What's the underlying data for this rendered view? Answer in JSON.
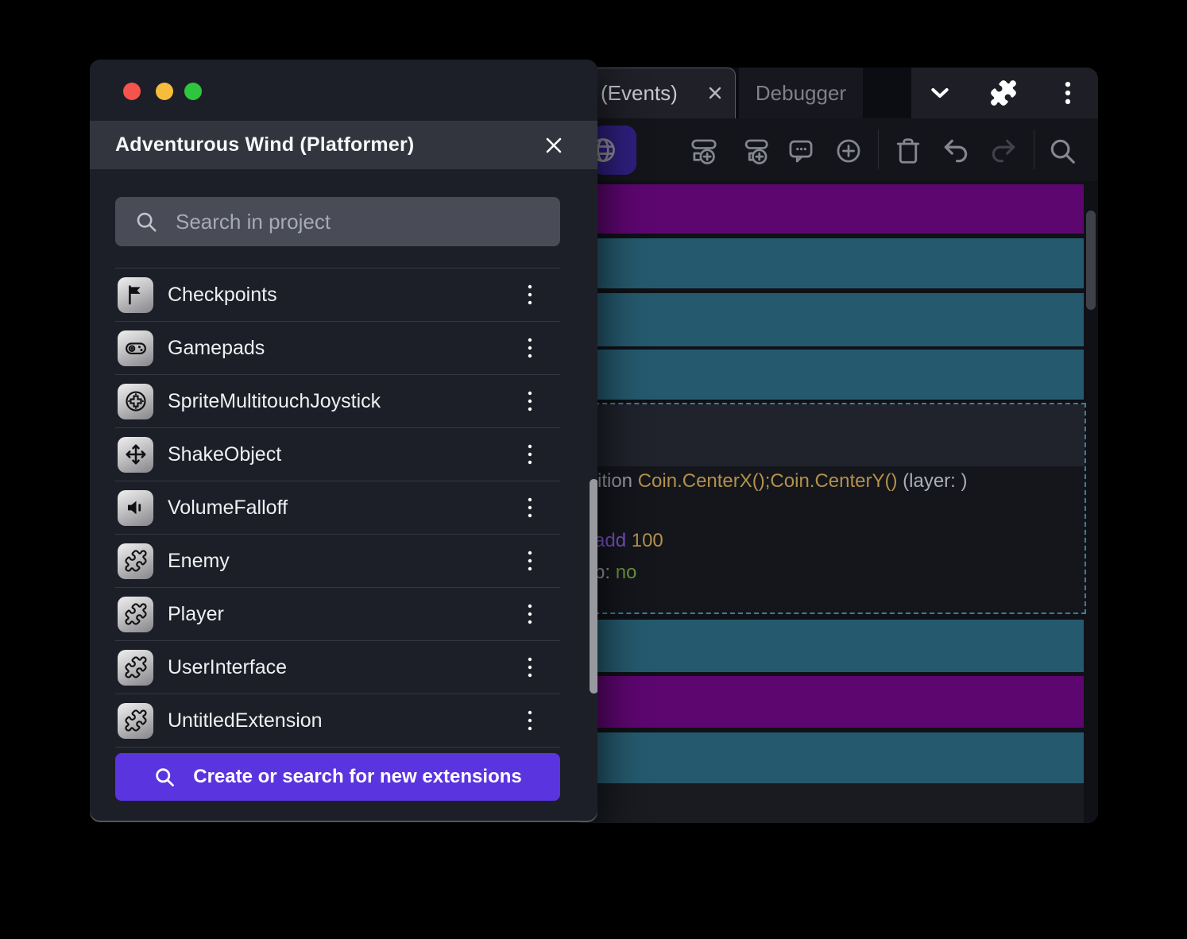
{
  "colors": {
    "row-purple": "#5d0670",
    "row-teal": "#255a6e",
    "accent-button": "#5a34df",
    "toolbar-accent": "#2e1f7e",
    "selection-border": "#3e7d99",
    "code-gold": "#b3914c",
    "code-purple": "#7b50c8",
    "code-green": "#6d9340",
    "code-gray": "#979ca6",
    "traffic-red": "#f4544c",
    "traffic-yellow": "#f6bd3c",
    "traffic-green": "#2dc63e"
  },
  "dialog": {
    "title": "Adventurous Wind (Platformer)",
    "search": {
      "placeholder": "Search in project",
      "icon": "search-icon"
    },
    "items": [
      {
        "label": "Checkpoints",
        "icon": "flag-icon"
      },
      {
        "label": "Gamepads",
        "icon": "gamepad-icon"
      },
      {
        "label": "SpriteMultitouchJoystick",
        "icon": "joystick-icon"
      },
      {
        "label": "ShakeObject",
        "icon": "move-arrows-icon"
      },
      {
        "label": "VolumeFalloff",
        "icon": "speaker-icon"
      },
      {
        "label": "Enemy",
        "icon": "puzzle-icon"
      },
      {
        "label": "Player",
        "icon": "puzzle-icon"
      },
      {
        "label": "UserInterface",
        "icon": "puzzle-icon"
      },
      {
        "label": "UntitledExtension",
        "icon": "puzzle-icon"
      }
    ],
    "create_button": {
      "label": "Create or search for new extensions",
      "icon": "search-icon"
    }
  },
  "editor": {
    "tabs": [
      {
        "label": "(Events)",
        "active": true,
        "closable": true
      },
      {
        "label": "Debugger",
        "active": false
      }
    ],
    "header_icons": [
      "chevron-down-icon",
      "puzzle-icon",
      "kebab-menu-icon"
    ],
    "toolbar_icons": [
      "globe-icon",
      "add-event-icon",
      "add-subevent-icon",
      "add-comment-icon",
      "add-circle-icon",
      "trash-icon",
      "undo-icon",
      "redo-icon",
      "search-icon"
    ],
    "code": {
      "l1_pre": "ition ",
      "l1_expr": "Coin.CenterX();Coin.CenterY()",
      "l1_suf": " (layer: )",
      "l2_kw": "add ",
      "l2_val": "100",
      "l3_pre": "p: ",
      "l3_val": "no"
    }
  }
}
